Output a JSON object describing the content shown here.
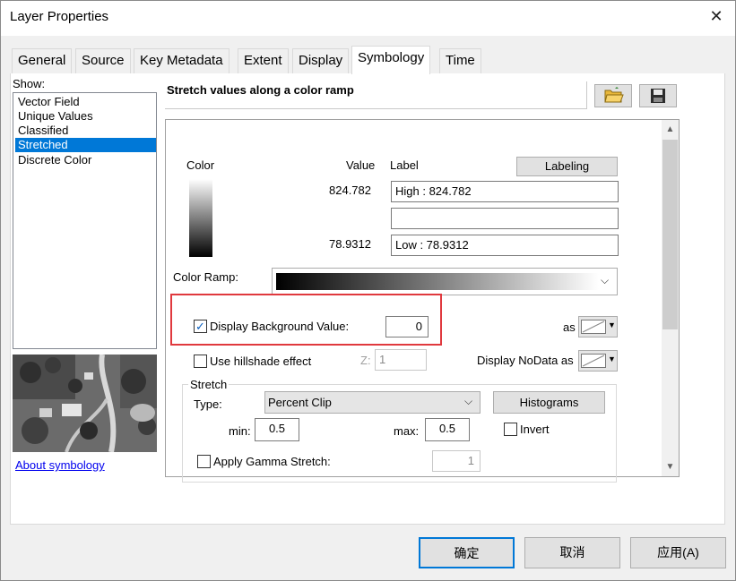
{
  "window": {
    "title": "Layer Properties"
  },
  "tabs": [
    {
      "label": "General"
    },
    {
      "label": "Source"
    },
    {
      "label": "Key Metadata"
    },
    {
      "label": "Extent"
    },
    {
      "label": "Display"
    },
    {
      "label": "Symbology"
    },
    {
      "label": "Time"
    }
  ],
  "active_tab": "Symbology",
  "show": {
    "label": "Show:",
    "items": [
      {
        "label": "Vector Field"
      },
      {
        "label": "Unique Values"
      },
      {
        "label": "Classified"
      },
      {
        "label": "Stretched"
      },
      {
        "label": "Discrete Color"
      }
    ],
    "selected": "Stretched",
    "about_link": "About symbology"
  },
  "symbology": {
    "description": "Stretch values along a color ramp",
    "toolbar_icons": [
      "open-folder-icon",
      "save-icon"
    ],
    "headers": {
      "color": "Color",
      "value": "Value",
      "label": "Label"
    },
    "labeling_button": "Labeling",
    "high": {
      "value": "824.782",
      "label": "High : 824.782"
    },
    "mid": {
      "label": ""
    },
    "low": {
      "value": "78.9312",
      "label": "Low : 78.9312"
    },
    "color_ramp_label": "Color Ramp:",
    "display_background": {
      "label": "Display Background Value:",
      "checked": true,
      "value": "0",
      "as_label": "as"
    },
    "hillshade": {
      "label": "Use hillshade effect",
      "checked": false,
      "z_label": "Z:",
      "z_value": "1"
    },
    "nodata_label": "Display NoData as",
    "stretch": {
      "group_label": "Stretch",
      "type_label": "Type:",
      "type_value": "Percent Clip",
      "histograms_button": "Histograms",
      "min_label": "min:",
      "min_value": "0.5",
      "max_label": "max:",
      "max_value": "0.5",
      "invert_label": "Invert",
      "invert_checked": false,
      "gamma_label": "Apply Gamma Stretch:",
      "gamma_checked": false,
      "gamma_value": "1"
    },
    "highlight_color": "#e0393e"
  },
  "buttons": {
    "ok": "确定",
    "cancel": "取消",
    "apply": "应用(A)"
  },
  "colors": {
    "accent": "#0078d7",
    "link": "#0000ee",
    "default_button_border": "#0078d7"
  }
}
